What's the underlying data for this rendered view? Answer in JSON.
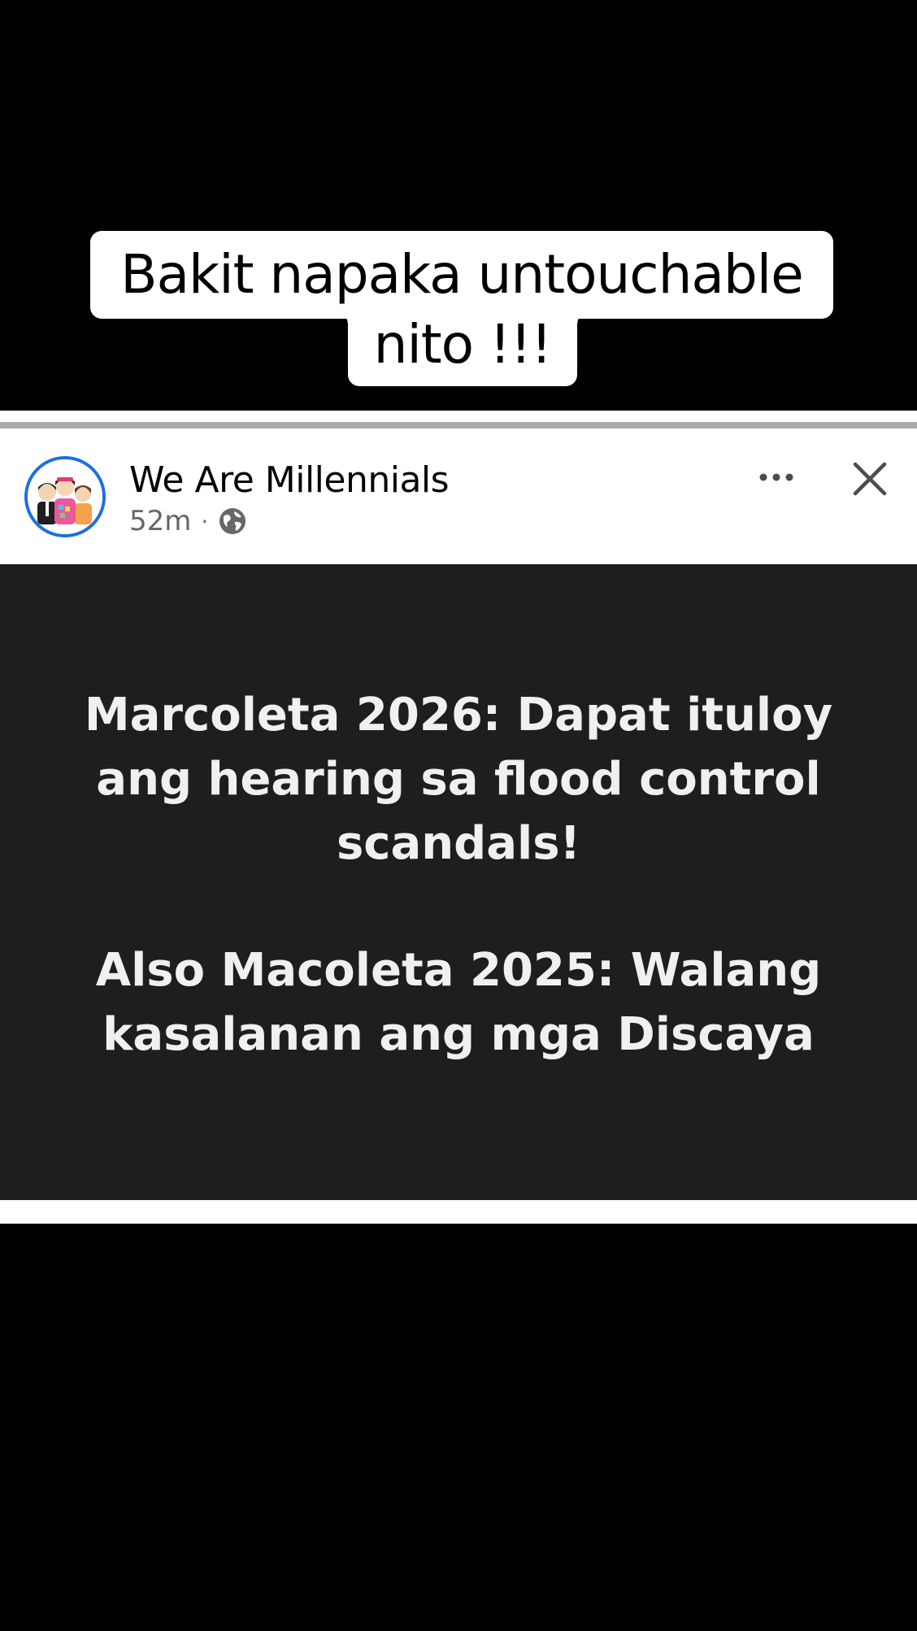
{
  "caption": {
    "line1": "Bakit napaka untouchable",
    "line2": "nito !!!"
  },
  "post": {
    "page_name": "We Are Millennials",
    "time": "52m",
    "separator": "·",
    "privacy_icon": "globe-icon",
    "more_icon": "more-horizontal-icon",
    "close_icon": "close-icon",
    "body": {
      "paragraph1": "Marcoleta 2026: Dapat ituloy ang hearing sa flood control scandals!",
      "paragraph2": "Also Macoleta 2025: Walang kasalanan ang mga Discaya"
    }
  },
  "colors": {
    "background": "#000000",
    "card": "#ffffff",
    "post_body_bg": "#1e1e1e",
    "post_text": "#f0f0f0",
    "avatar_ring": "#1d6fe0",
    "meta_text": "#65676b"
  }
}
